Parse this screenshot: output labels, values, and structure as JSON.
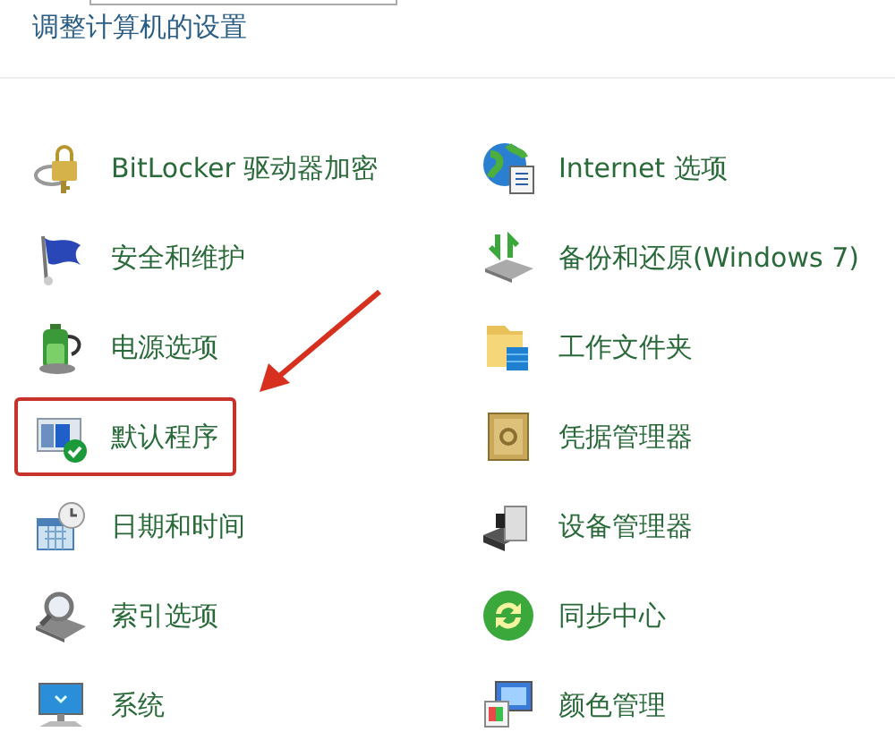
{
  "title": "调整计算机的设置",
  "left_column": [
    {
      "label": "BitLocker 驱动器加密",
      "highlighted": false
    },
    {
      "label": "安全和维护",
      "highlighted": false
    },
    {
      "label": "电源选项",
      "highlighted": false
    },
    {
      "label": "默认程序",
      "highlighted": true
    },
    {
      "label": "日期和时间",
      "highlighted": false
    },
    {
      "label": "索引选项",
      "highlighted": false
    },
    {
      "label": "系统",
      "highlighted": false
    }
  ],
  "right_column": [
    {
      "label": "Internet 选项",
      "highlighted": false
    },
    {
      "label": "备份和还原(Windows 7)",
      "highlighted": false
    },
    {
      "label": "工作文件夹",
      "highlighted": false
    },
    {
      "label": "凭据管理器",
      "highlighted": false
    },
    {
      "label": "设备管理器",
      "highlighted": false
    },
    {
      "label": "同步中心",
      "highlighted": false
    },
    {
      "label": "颜色管理",
      "highlighted": false
    }
  ]
}
